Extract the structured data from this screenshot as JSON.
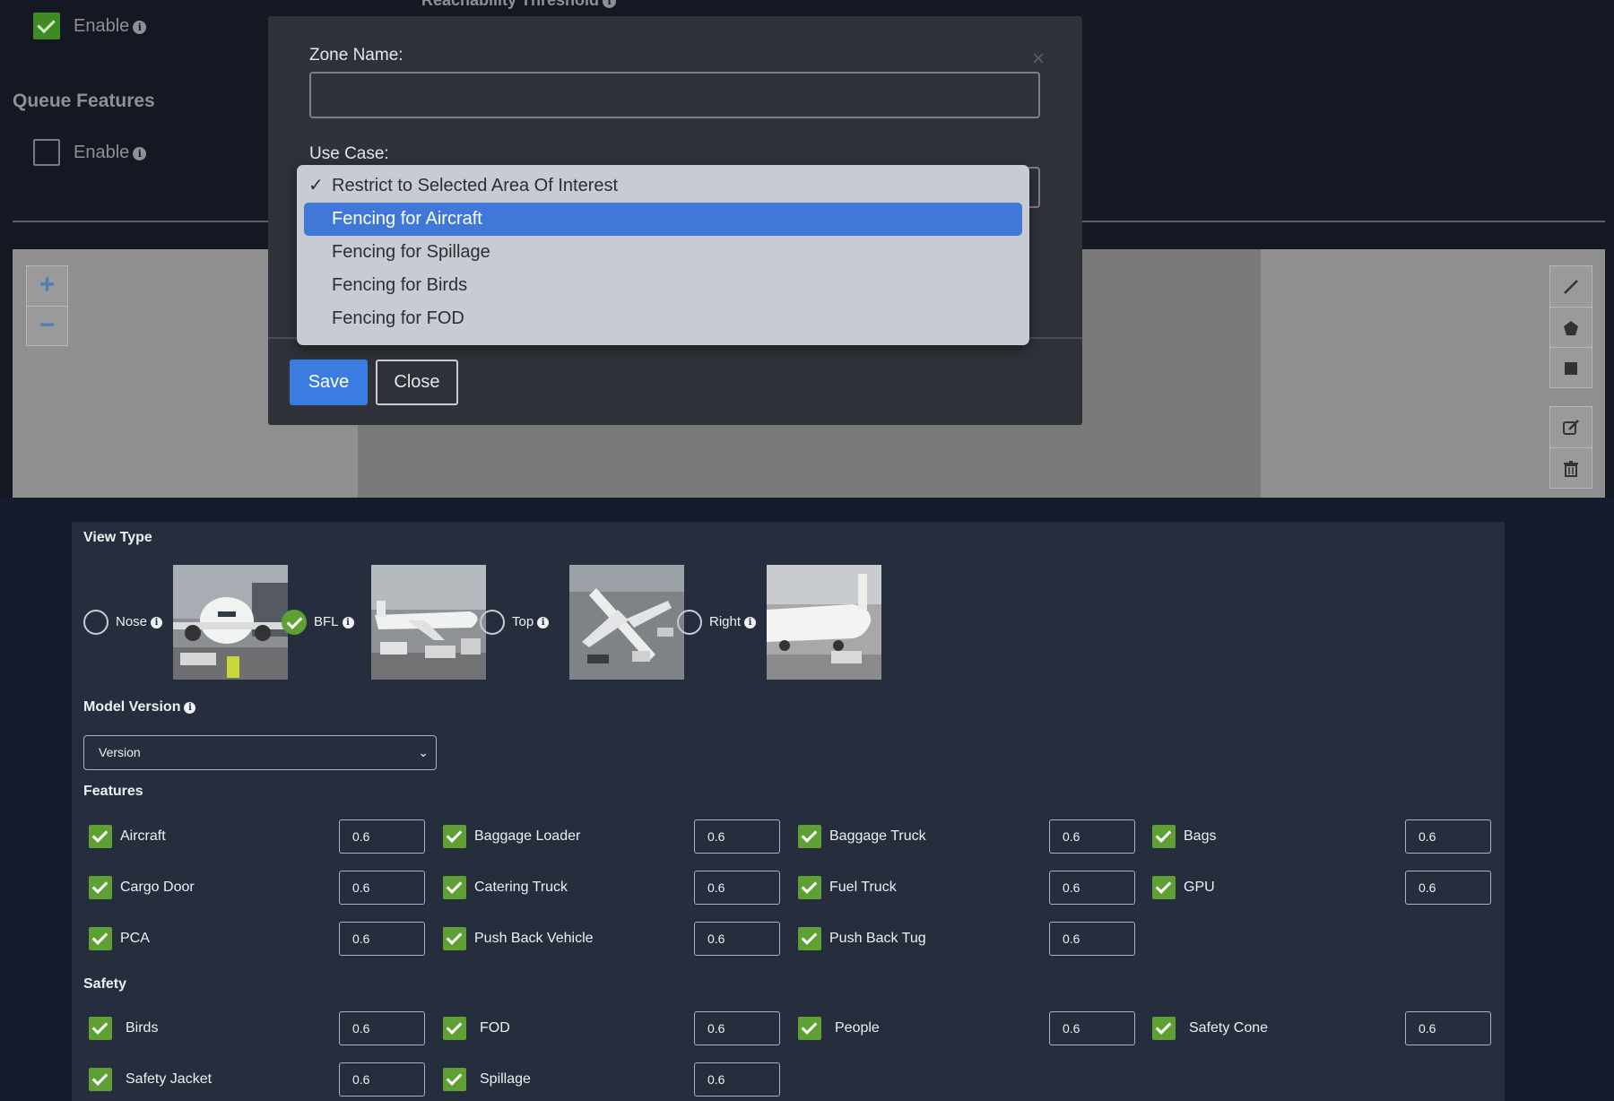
{
  "background": {
    "threshold_label": "Reachability Threshold",
    "enable_label_1": "Enable",
    "queue_features_title": "Queue Features",
    "enable_label_2": "Enable",
    "zoom_in": "+",
    "zoom_out": "−"
  },
  "modal": {
    "zone_name_label": "Zone Name:",
    "zone_name_value": "",
    "use_case_label": "Use Case:",
    "close_x": "×",
    "save_label": "Save",
    "close_label": "Close",
    "use_case_options": [
      {
        "label": "Restrict to Selected Area Of Interest",
        "selected": true
      },
      {
        "label": "Fencing for Aircraft",
        "highlighted": true
      },
      {
        "label": "Fencing for Spillage"
      },
      {
        "label": "Fencing for Birds"
      },
      {
        "label": "Fencing for FOD"
      }
    ]
  },
  "config": {
    "view_type_title": "View Type",
    "view_types": [
      {
        "label": "Nose",
        "selected": false
      },
      {
        "label": "BFL",
        "selected": true
      },
      {
        "label": "Top",
        "selected": false
      },
      {
        "label": "Right",
        "selected": false
      }
    ],
    "model_version_title": "Model Version",
    "model_version_value": "Version",
    "features_title": "Features",
    "features": [
      {
        "label": "Aircraft",
        "value": "0.6"
      },
      {
        "label": "Baggage Loader",
        "value": "0.6"
      },
      {
        "label": "Baggage Truck",
        "value": "0.6"
      },
      {
        "label": "Bags",
        "value": "0.6"
      },
      {
        "label": "Cargo Door",
        "value": "0.6"
      },
      {
        "label": "Catering Truck",
        "value": "0.6"
      },
      {
        "label": "Fuel Truck",
        "value": "0.6"
      },
      {
        "label": "GPU",
        "value": "0.6"
      },
      {
        "label": "PCA",
        "value": "0.6"
      },
      {
        "label": "Push Back Vehicle",
        "value": "0.6"
      },
      {
        "label": "Push Back Tug",
        "value": "0.6"
      }
    ],
    "safety_title": "Safety",
    "safety": [
      {
        "label": "Birds",
        "value": "0.6"
      },
      {
        "label": "FOD",
        "value": "0.6"
      },
      {
        "label": "People",
        "value": "0.6"
      },
      {
        "label": "Safety Cone",
        "value": "0.6"
      },
      {
        "label": "Safety Jacket",
        "value": "0.6"
      },
      {
        "label": "Spillage",
        "value": "0.6"
      }
    ]
  },
  "icons": {
    "check": "check-icon",
    "info": "info-icon",
    "chevron": "chevron-down-icon",
    "line": "draw-line-icon",
    "polygon": "draw-polygon-icon",
    "rectangle": "draw-rectangle-icon",
    "edit": "edit-icon",
    "trash": "trash-icon"
  },
  "colors": {
    "accent_blue": "#3b7ce0",
    "check_green": "#5fa034",
    "panel_bg": "#262d3c",
    "modal_bg": "#2f3239"
  }
}
